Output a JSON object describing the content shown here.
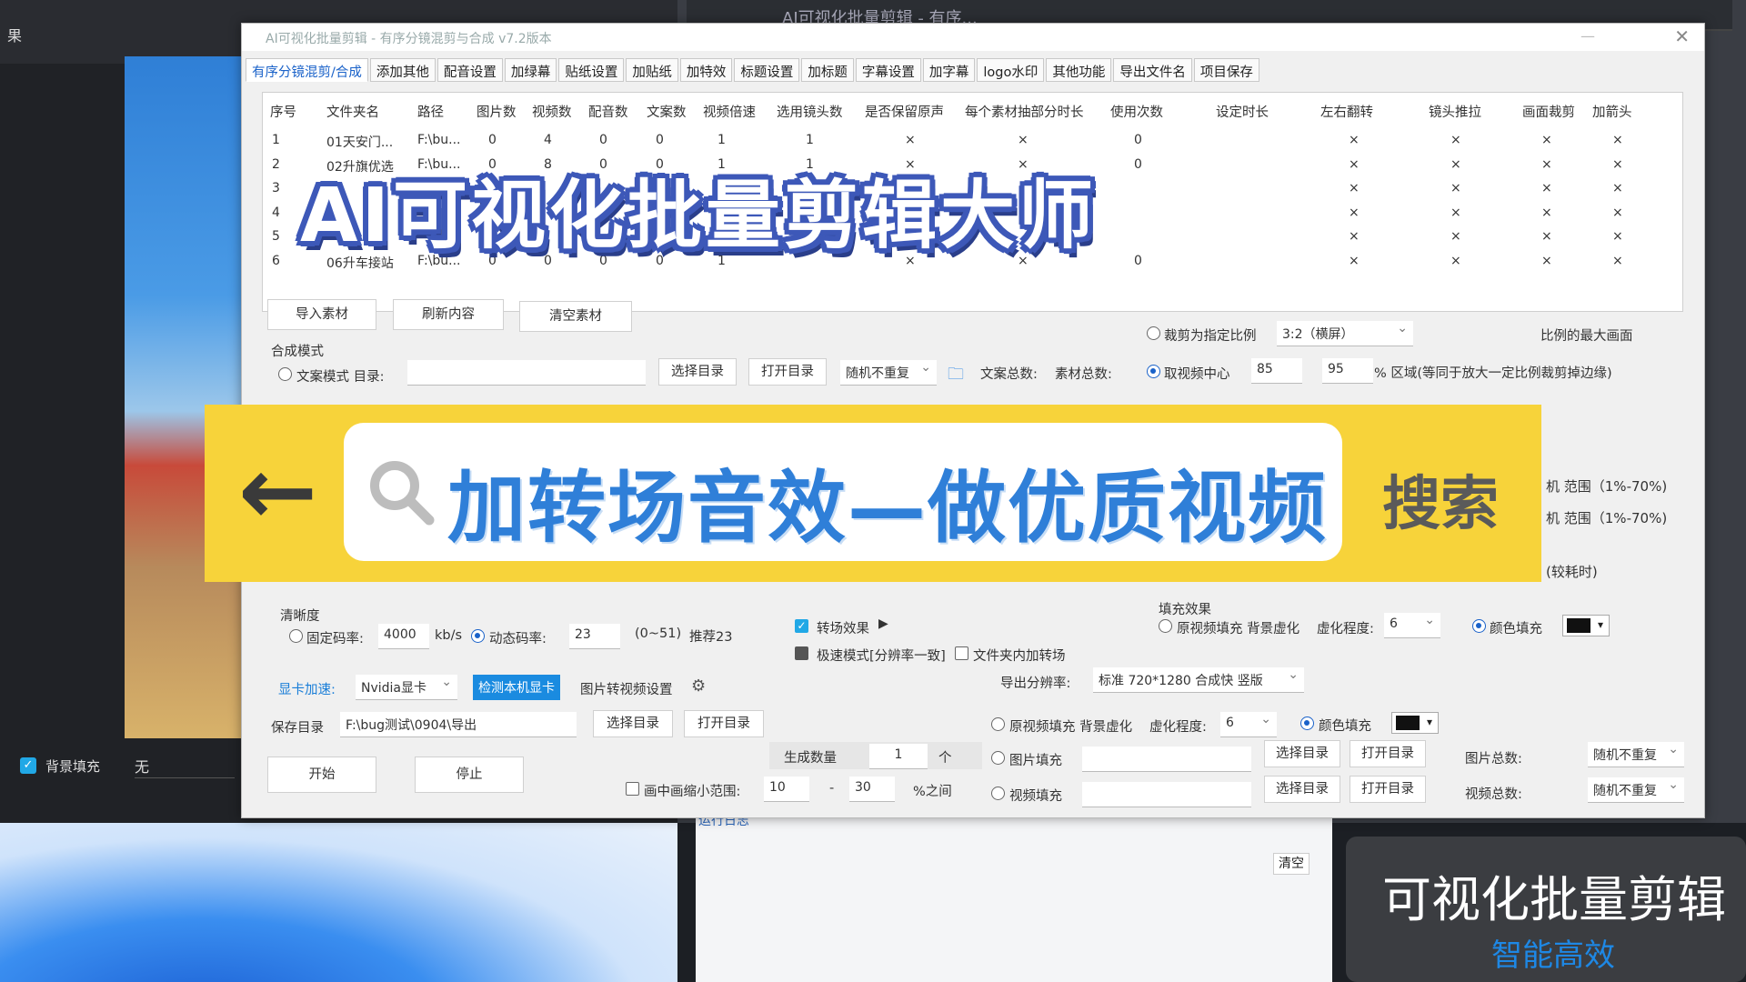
{
  "background": {
    "left_label": "果",
    "bg_fill_label": "背景填充",
    "bg_fill_value": "无",
    "right_title": "AI可视化批量剪辑 - 有序...",
    "log_label": "运行日志",
    "log_clear": "清空"
  },
  "window": {
    "title": "AI可视化批量剪辑 - 有序分镜混剪与合成 v7.2版本",
    "min": "—",
    "close": "✕"
  },
  "tabs": [
    "有序分镜混剪/合成",
    "添加其他",
    "配音设置",
    "加绿幕",
    "贴纸设置",
    "加贴纸",
    "加特效",
    "标题设置",
    "加标题",
    "字幕设置",
    "加字幕",
    "logo水印",
    "其他功能",
    "导出文件名",
    "项目保存"
  ],
  "table": {
    "headers": [
      "序号",
      "文件夹名",
      "路径",
      "图片数",
      "视频数",
      "配音数",
      "文案数",
      "视频倍速",
      "选用镜头数",
      "是否保留原声",
      "每个素材抽部分时长",
      "使用次数",
      "设定时长",
      "左右翻转",
      "镜头推拉",
      "画面裁剪",
      "加箭头"
    ],
    "rows": [
      [
        "1",
        "01天安门...",
        "F:\\bu...",
        "0",
        "4",
        "0",
        "0",
        "1",
        "1",
        "×",
        "×",
        "0",
        "",
        "×",
        "×",
        "×",
        "×"
      ],
      [
        "2",
        "02升旗优选",
        "F:\\bu...",
        "0",
        "8",
        "0",
        "0",
        "1",
        "1",
        "×",
        "×",
        "0",
        "",
        "×",
        "×",
        "×",
        "×"
      ],
      [
        "3",
        "",
        "",
        "",
        "",
        "",
        "",
        "",
        "",
        "",
        "",
        "",
        "",
        "×",
        "×",
        "×",
        "×"
      ],
      [
        "4",
        "",
        "",
        "",
        "",
        "",
        "",
        "",
        "",
        "",
        "",
        "",
        "",
        "×",
        "×",
        "×",
        "×"
      ],
      [
        "5",
        "",
        "",
        "",
        "",
        "",
        "",
        "",
        "",
        "",
        "",
        "",
        "",
        "×",
        "×",
        "×",
        "×"
      ],
      [
        "6",
        "06升车接站",
        "F:\\bu...",
        "0",
        "0",
        "0",
        "0",
        "1",
        "",
        "×",
        "×",
        "0",
        "",
        "×",
        "×",
        "×",
        "×"
      ]
    ]
  },
  "buttons": {
    "import": "导入素材",
    "refresh": "刷新内容",
    "clear": "清空素材",
    "choose_dir": "选择目录",
    "open_dir": "打开目录",
    "start": "开始",
    "stop": "停止",
    "detect_gpu": "检测本机显卡"
  },
  "compose": {
    "mode_label": "合成模式",
    "text_mode": "文案模式 目录:",
    "random_no_repeat": "随机不重复",
    "text_total": "文案总数:",
    "material_total": "素材总数:"
  },
  "crop": {
    "crop_ratio": "裁剪为指定比例",
    "ratio_value": "3:2（横屏）",
    "max_frame": "比例的最大画面",
    "take_center": "取视频中心",
    "w": "85",
    "h": "95",
    "region_note": "% 区域(等同于放大一定比例裁剪掉边缘)",
    "range1": "机 范围（1%-70%)",
    "range2": "机 范围（1%-70%)",
    "slow": "(较耗时)"
  },
  "clarity": {
    "label": "清晰度",
    "fixed": "固定码率:",
    "fixed_val": "4000",
    "unit": "kb/s",
    "dynamic": "动态码率:",
    "dynamic_val": "23",
    "range": "(0~51)",
    "recommend": "推荐23"
  },
  "transition": {
    "effect": "转场效果",
    "fast_mode": "极速模式[分辨率一致]",
    "folder_transition": "文件夹内加转场"
  },
  "fill": {
    "label": "填充效果",
    "orig_blur": "原视频填充 背景虚化",
    "blur_level": "虚化程度:",
    "blur_val": "6",
    "color_fill": "颜色填充"
  },
  "gpu": {
    "label": "显卡加速:",
    "value": "Nvidia显卡",
    "img_to_video": "图片转视频设置"
  },
  "export": {
    "resolution_label": "导出分辨率:",
    "resolution_value": "标准 720*1280 合成快 竖版",
    "orig_blur": "原视频填充 背景虚化",
    "blur_level": "虚化程度:",
    "blur_val": "6",
    "color_fill": "颜色填充",
    "img_fill": "图片填充",
    "img_total": "图片总数:",
    "video_fill": "视频填充",
    "video_total": "视频总数:",
    "random_no_repeat": "随机不重复"
  },
  "save": {
    "label": "保存目录",
    "path": "F:\\bug测试\\0904\\导出",
    "gen_count": "生成数量",
    "gen_val": "1",
    "gen_unit": "个",
    "shrink": "画中画缩小范围:",
    "shrink_min": "10",
    "dash": "-",
    "shrink_max": "30",
    "shrink_unit": "%之间"
  },
  "overlay": {
    "big_title": "AI可视化批量剪辑大师",
    "search_text": "加转场音效—做优质视频",
    "search_btn": "搜索",
    "promo_title": "可视化批量剪辑",
    "promo_sub": "智能高效"
  }
}
